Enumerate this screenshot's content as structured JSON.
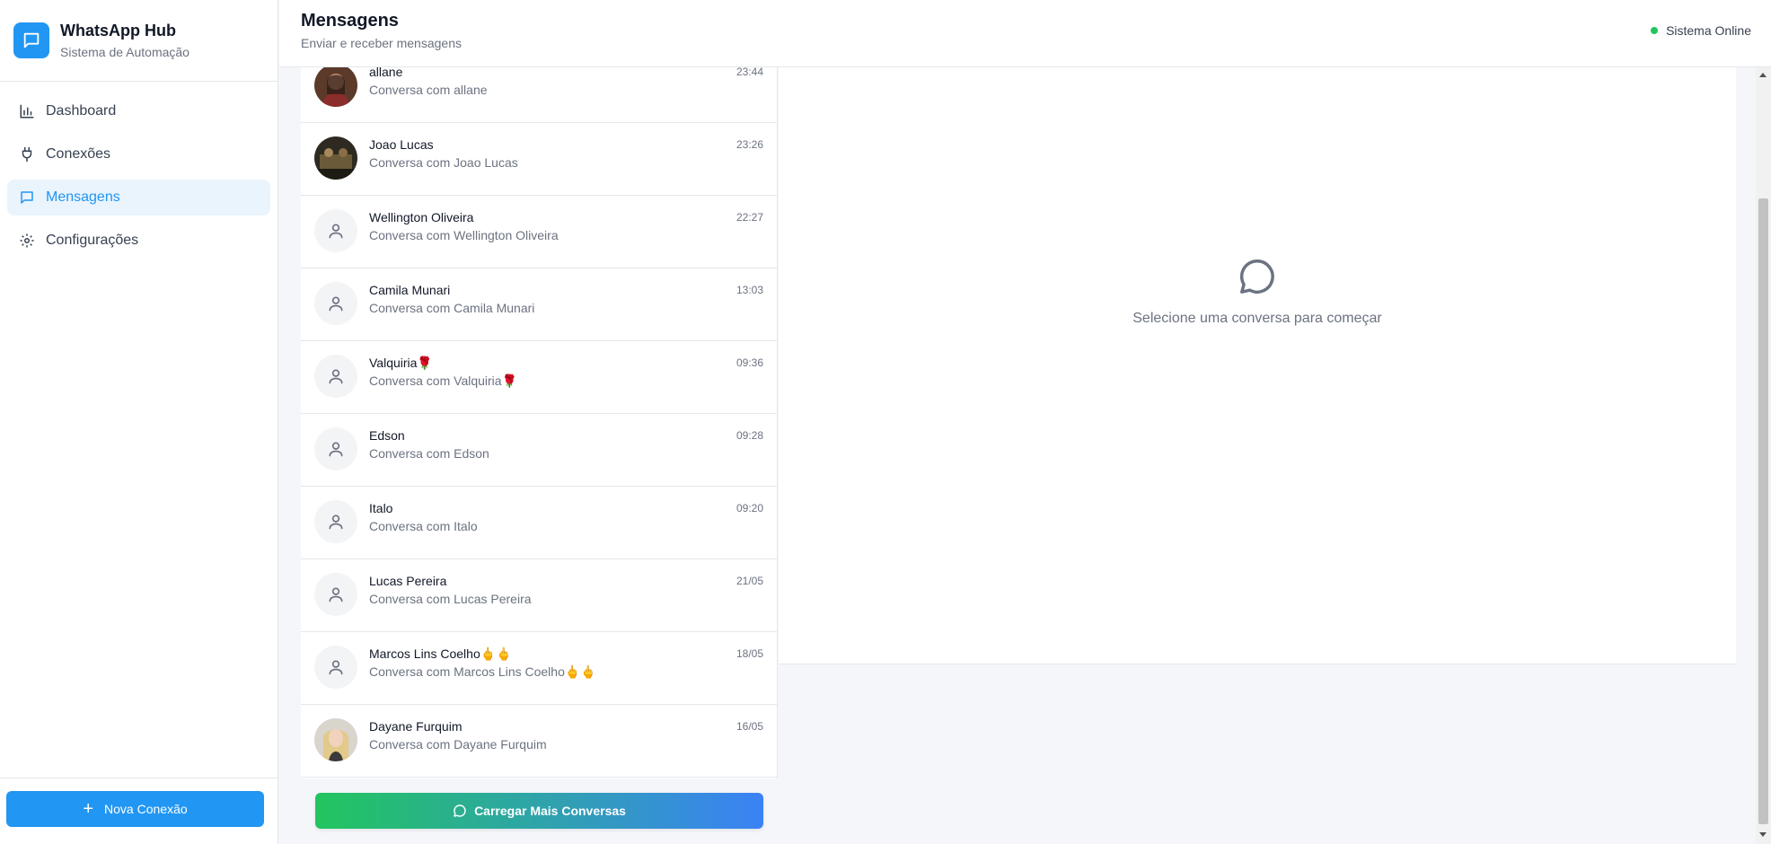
{
  "brand": {
    "title": "WhatsApp Hub",
    "subtitle": "Sistema de Automação"
  },
  "nav": [
    {
      "label": "Dashboard",
      "icon": "bar-chart-icon",
      "active": false
    },
    {
      "label": "Conexões",
      "icon": "plug-icon",
      "active": false
    },
    {
      "label": "Mensagens",
      "icon": "message-icon",
      "active": true
    },
    {
      "label": "Configurações",
      "icon": "gear-icon",
      "active": false
    }
  ],
  "sidebar_footer": {
    "new_connection_label": "Nova Conexão"
  },
  "header": {
    "title": "Mensagens",
    "subtitle": "Enviar e receber mensagens",
    "status": "Sistema Online"
  },
  "conversations": [
    {
      "name": "allane",
      "preview": "Conversa com allane",
      "time": "23:44",
      "avatar": "photo"
    },
    {
      "name": "Joao Lucas",
      "preview": "Conversa com Joao Lucas",
      "time": "23:26",
      "avatar": "photo"
    },
    {
      "name": "Wellington Oliveira",
      "preview": "Conversa com Wellington Oliveira",
      "time": "22:27",
      "avatar": "default"
    },
    {
      "name": "Camila Munari",
      "preview": "Conversa com Camila Munari",
      "time": "13:03",
      "avatar": "default"
    },
    {
      "name": "Valquiria🌹",
      "preview": "Conversa com Valquiria🌹",
      "time": "09:36",
      "avatar": "default"
    },
    {
      "name": "Edson",
      "preview": "Conversa com Edson",
      "time": "09:28",
      "avatar": "default"
    },
    {
      "name": "Italo",
      "preview": "Conversa com Italo",
      "time": "09:20",
      "avatar": "default"
    },
    {
      "name": "Lucas Pereira",
      "preview": "Conversa com Lucas Pereira",
      "time": "21/05",
      "avatar": "default"
    },
    {
      "name": "Marcos Lins Coelho🖕🖕",
      "preview": "Conversa com Marcos Lins Coelho🖕🖕",
      "time": "18/05",
      "avatar": "default"
    },
    {
      "name": "Dayane Furquim",
      "preview": "Conversa com Dayane Furquim",
      "time": "16/05",
      "avatar": "photo"
    }
  ],
  "load_more_label": "Carregar Mais Conversas",
  "empty_state": {
    "text": "Selecione uma conversa para começar"
  },
  "colors": {
    "accent": "#2196f3",
    "online": "#22c55e",
    "gradient_start": "#22c55e",
    "gradient_end": "#3b82f6"
  }
}
